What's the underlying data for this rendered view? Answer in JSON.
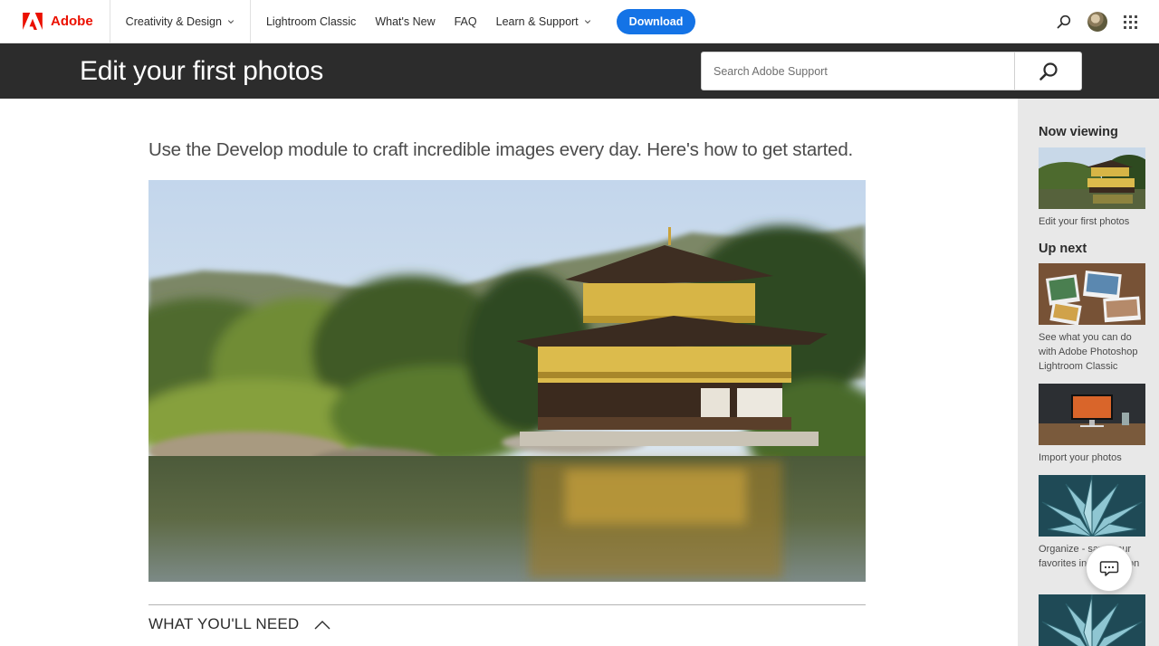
{
  "nav": {
    "brand": "Adobe",
    "category": "Creativity & Design",
    "links": [
      "Lightroom Classic",
      "What's New",
      "FAQ",
      "Learn & Support"
    ],
    "download": "Download"
  },
  "header": {
    "title": "Edit your first photos",
    "search_placeholder": "Search Adobe Support"
  },
  "main": {
    "intro": "Use the Develop module to craft incredible images every day. Here's how to get started.",
    "section_label": "WHAT YOU'LL NEED"
  },
  "sidebar": {
    "now_viewing_heading": "Now viewing",
    "now_viewing_caption": "Edit your first photos",
    "up_next_heading": "Up next",
    "up_next": [
      {
        "caption": "See what you can do with Adobe Photoshop Lightroom Classic"
      },
      {
        "caption": "Import your photos"
      },
      {
        "caption": "Organize - save your favorites in a collection"
      }
    ]
  },
  "colors": {
    "brand_red": "#eb1000",
    "accent_blue": "#1473e6",
    "title_bar": "#2c2c2c",
    "sidebar_bg": "#e8e8e8"
  },
  "icons": [
    "adobe-logo-icon",
    "chevron-down-icon",
    "search-icon",
    "apps-grid-icon",
    "chevron-up-icon",
    "chat-icon"
  ]
}
